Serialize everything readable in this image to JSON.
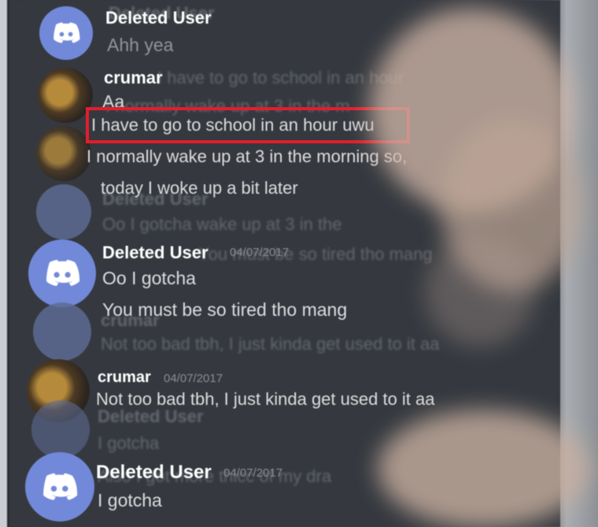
{
  "messages": [
    {
      "username": "Deleted User",
      "text": "Ahh yea"
    },
    {
      "username": "crumar",
      "text": "Aa"
    },
    {
      "username": "",
      "text": "I have to go to school in an hour uwu"
    },
    {
      "username": "",
      "text": "I normally wake up at 3 in the morning so, "
    },
    {
      "username": "",
      "text": "today I woke up a bit later"
    },
    {
      "username": "Deleted User",
      "timestamp": "04/07/2017",
      "text": "Oo I gotcha"
    },
    {
      "username": "",
      "text": "You must be so tired tho mang"
    },
    {
      "username": "crumar",
      "timestamp": "04/07/2017",
      "text": "Not too bad tbh, I just kinda get used to it aa"
    },
    {
      "username": "Deleted User",
      "timestamp": "04/07/2017",
      "text": "I gotcha"
    }
  ],
  "ghost_text": {
    "g1": "Deleted User",
    "g2": "I have to go to school in an hour",
    "g3": "I normally wake up at 3 in the m",
    "g4": "Deleted User",
    "g5": "Oo I gotcha wake up at 3 in the",
    "g6": "You must be so tired tho mang",
    "g7": "crumar",
    "g8": "Not too bad tbh, I just kinda get used to it aa",
    "g9": "Deleted User",
    "g10": "I gotcha",
    "g11": "Also I got more thicc of my dra"
  },
  "colors": {
    "highlight": "#e01e2b",
    "discord_blurple": "#7289da"
  }
}
